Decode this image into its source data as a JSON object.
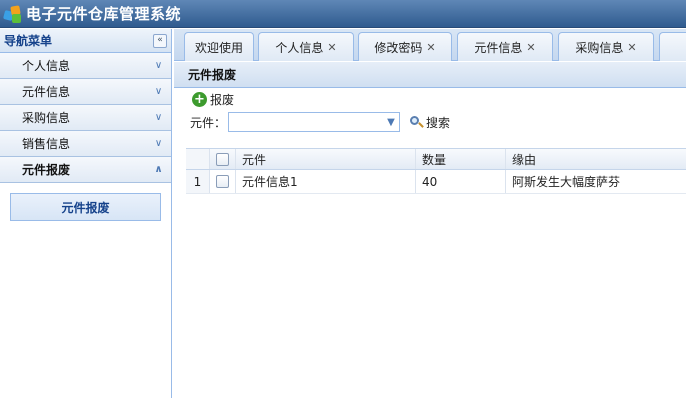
{
  "header": {
    "title": "电子元件仓库管理系统"
  },
  "sidebar": {
    "title": "导航菜单",
    "collapse_label": "«",
    "items": [
      {
        "label": "个人信息"
      },
      {
        "label": "元件信息"
      },
      {
        "label": "采购信息"
      },
      {
        "label": "销售信息"
      },
      {
        "label": "元件报废"
      }
    ],
    "sub_items": [
      {
        "label": "元件报废"
      }
    ]
  },
  "tabs": [
    {
      "label": "欢迎使用"
    },
    {
      "label": "个人信息"
    },
    {
      "label": "修改密码"
    },
    {
      "label": "元件信息"
    },
    {
      "label": "采购信息"
    }
  ],
  "main": {
    "panel_title": "元件报废",
    "add_label": "报废",
    "search": {
      "label": "元件：",
      "value": "",
      "button_label": "搜索"
    },
    "grid": {
      "columns": [
        "元件",
        "数量",
        "缘由"
      ],
      "rows": [
        {
          "index": "1",
          "name": "元件信息1",
          "qty": "40",
          "reason": "阿斯发生大幅度萨芬"
        }
      ]
    }
  },
  "colors": {
    "header": "#3d6a9f",
    "border": "#99bbe8",
    "accent": "#15428b"
  }
}
